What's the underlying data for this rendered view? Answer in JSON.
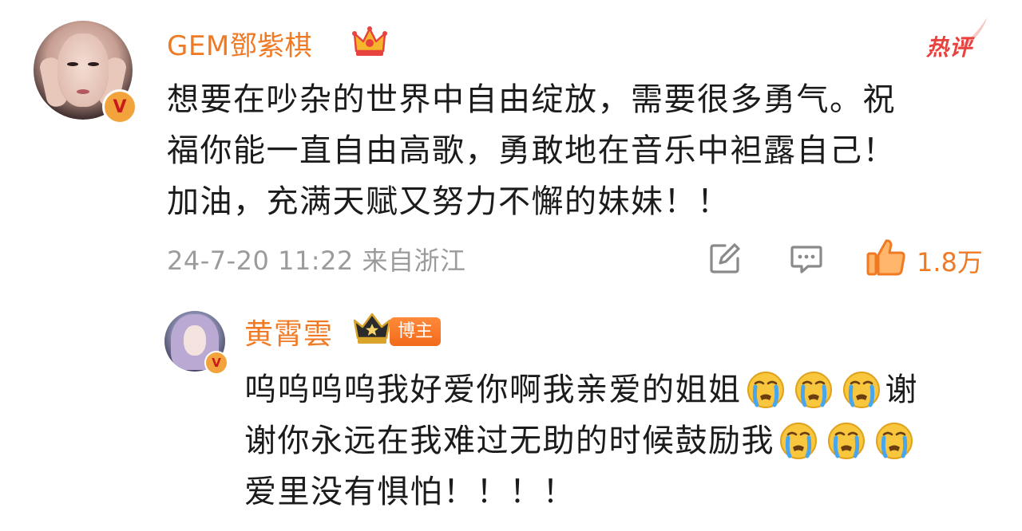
{
  "main_comment": {
    "username": "GEM鄧紫棋",
    "verified_badge": "V",
    "badge_icon": "crown-icon",
    "hot_label": "热评",
    "text_lines": [
      "想要在吵杂的世界中自由绽放，需要很多勇气。祝",
      "福你能一直自由高歌，勇敢地在音乐中袒露自己！",
      "加油，充满天赋又努力不懈的妹妹！！"
    ],
    "timestamp": "24-7-20 11:22 来自浙江",
    "actions": {
      "share_icon": "share-icon",
      "reply_icon": "comment-icon",
      "like_icon": "thumbs-up-icon",
      "like_count": "1.8万"
    }
  },
  "reply": {
    "username": "黄霄雲",
    "verified_badge": "V",
    "badge_icon": "vip-crown-icon",
    "role_badge": "博主",
    "line1_text": "呜呜呜呜我好爱你啊我亲爱的姐姐",
    "line1_suffix": "谢",
    "line2_text": "谢你永远在我难过无助的时候鼓励我",
    "line3_text": "爱里没有惧怕！！！！",
    "emoji_icon": "crying-face-icon"
  },
  "colors": {
    "accent": "#f07a24",
    "hot": "#e8423f",
    "text": "#1b1b1b",
    "meta": "#9b9b9b"
  }
}
